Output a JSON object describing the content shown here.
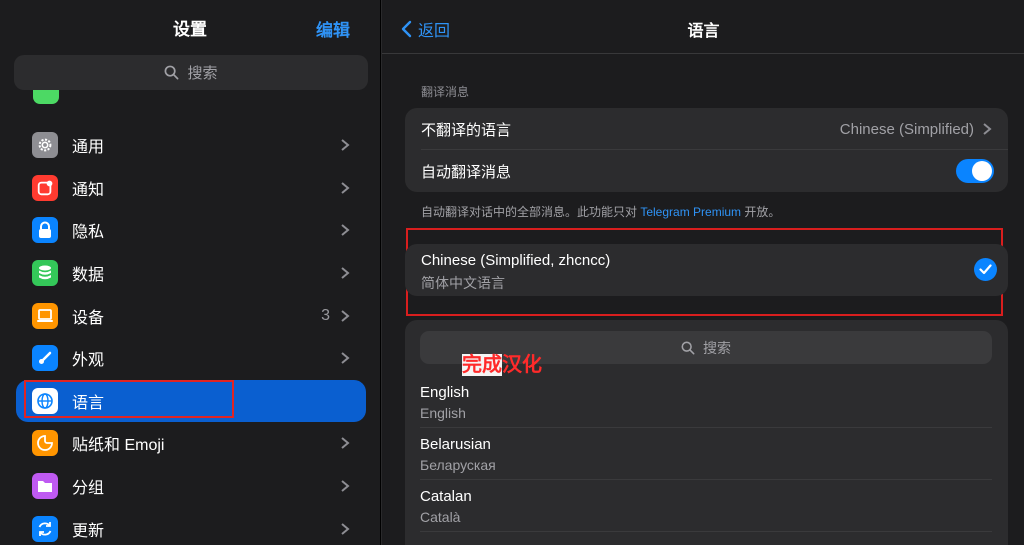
{
  "sidebar": {
    "title": "设置",
    "edit_label": "编辑",
    "search_placeholder": "搜索",
    "items": [
      {
        "label": "通用",
        "icon": "gear-icon",
        "color": "#8e8e93",
        "badge": ""
      },
      {
        "label": "通知",
        "icon": "notification-icon",
        "color": "#ff3b30",
        "badge": ""
      },
      {
        "label": "隐私",
        "icon": "lock-icon",
        "color": "#0a84ff",
        "badge": ""
      },
      {
        "label": "数据",
        "icon": "database-icon",
        "color": "#34c759",
        "badge": ""
      },
      {
        "label": "设备",
        "icon": "laptop-icon",
        "color": "#ff9500",
        "badge": "3"
      },
      {
        "label": "外观",
        "icon": "brush-icon",
        "color": "#0a84ff",
        "badge": ""
      },
      {
        "label": "语言",
        "icon": "globe-icon",
        "color": "#0a84ff",
        "badge": ""
      },
      {
        "label": "贴纸和 Emoji",
        "icon": "sticker-icon",
        "color": "#ff9500",
        "badge": ""
      },
      {
        "label": "分组",
        "icon": "folder-icon",
        "color": "#bf5af2",
        "badge": ""
      },
      {
        "label": "更新",
        "icon": "refresh-icon",
        "color": "#0a84ff",
        "badge": ""
      }
    ],
    "selected_index": 6
  },
  "detail": {
    "back_label": "返回",
    "title": "语言",
    "section_header": "翻译消息",
    "rows": {
      "do_not_translate_label": "不翻译的语言",
      "do_not_translate_value": "Chinese (Simplified)",
      "auto_translate_label": "自动翻译消息",
      "auto_translate_on": true
    },
    "footnote_prefix": "自动翻译对话中的全部消息。此功能只对 ",
    "footnote_link": "Telegram Premium",
    "footnote_suffix": " 开放。",
    "current_language": {
      "name": "Chinese (Simplified, zhcncc)",
      "native": "简体中文语言"
    },
    "list_search_placeholder": "搜索",
    "languages": [
      {
        "name": "English",
        "native": "English"
      },
      {
        "name": "Belarusian",
        "native": "Беларуская"
      },
      {
        "name": "Catalan",
        "native": "Català"
      }
    ],
    "colors": {
      "accent": "#0a84ff",
      "highlight": "#e02424"
    }
  },
  "overlay": {
    "part1": "完成",
    "part2": "汉化"
  }
}
